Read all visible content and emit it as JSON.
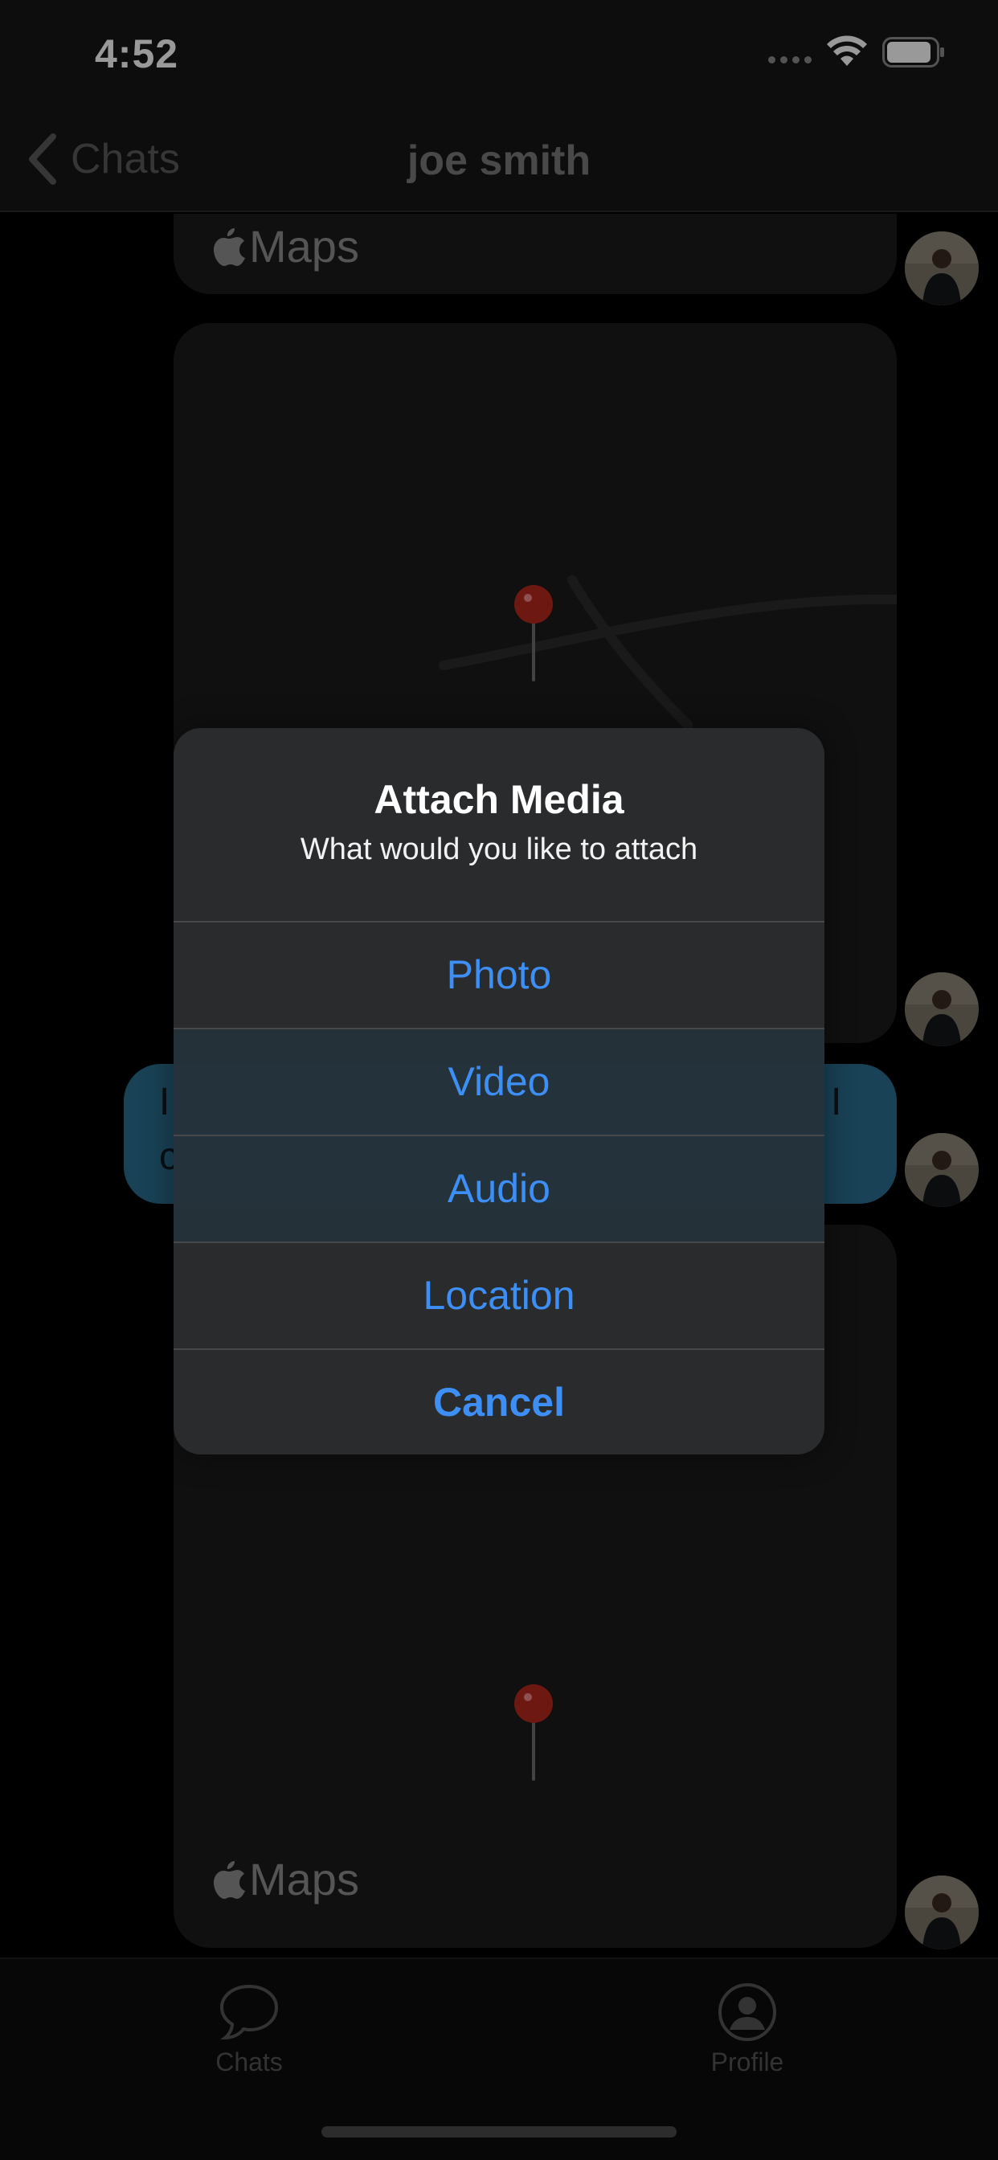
{
  "status_bar": {
    "time": "4:52"
  },
  "nav": {
    "back_label": "Chats",
    "title": "joe smith"
  },
  "chat": {
    "maps_brand_top": "Maps",
    "maps_brand_bottom": "Maps",
    "partial_text_left_1": "I",
    "partial_text_left_2": "c",
    "partial_text_right": "I"
  },
  "alert": {
    "title": "Attach Media",
    "message": "What would you like to attach",
    "actions": [
      "Photo",
      "Video",
      "Audio",
      "Location"
    ],
    "cancel": "Cancel"
  },
  "tabs": [
    {
      "label": "Chats",
      "icon": "chat-bubble-icon"
    },
    {
      "label": "Profile",
      "icon": "person-circle-icon"
    }
  ],
  "colors": {
    "action_blue": "#3d8ff5",
    "sent_bubble": "#2a6f8f",
    "pin_red": "#c0302a"
  }
}
